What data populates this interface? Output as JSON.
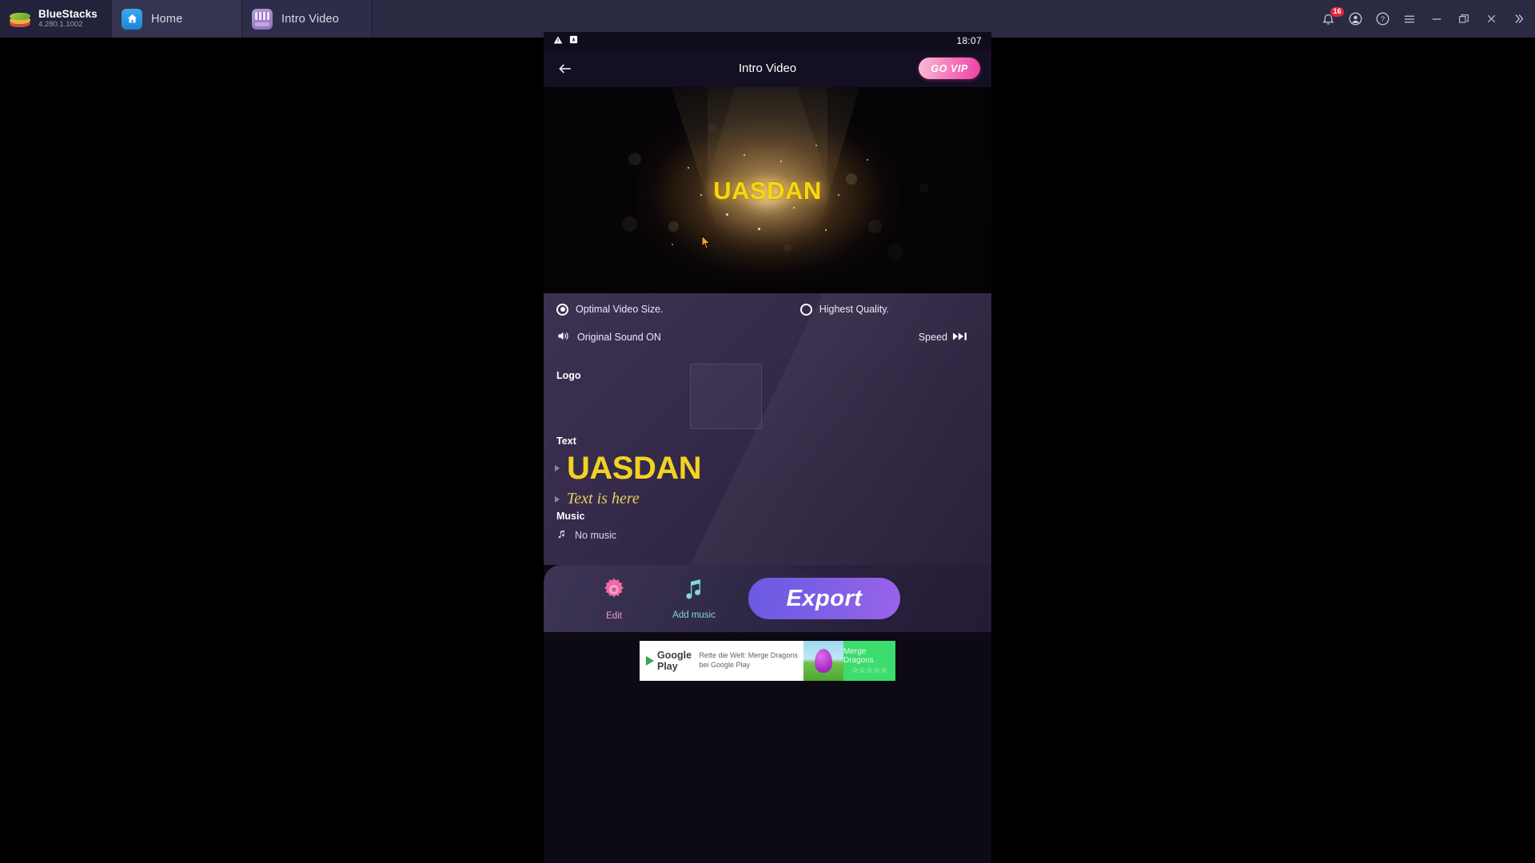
{
  "window": {
    "brand": "BlueStacks",
    "version": "4.280.1.1002",
    "tabs": [
      {
        "label": "Home",
        "icon": "home-icon",
        "active": false
      },
      {
        "label": "Intro Video",
        "icon": "intro-video-app-icon",
        "active": true
      }
    ],
    "system_icons": [
      {
        "name": "notifications-icon",
        "badge": "16"
      },
      {
        "name": "account-icon"
      },
      {
        "name": "help-icon"
      },
      {
        "name": "menu-icon"
      },
      {
        "name": "minimize-icon"
      },
      {
        "name": "restore-icon"
      },
      {
        "name": "close-icon"
      },
      {
        "name": "expand-sidebar-icon"
      }
    ]
  },
  "android": {
    "statusbar": {
      "time": "18:07",
      "icons": [
        "warning-icon",
        "adb-icon"
      ]
    },
    "appbar": {
      "title": "Intro Video",
      "back": "back-arrow-icon",
      "vip_label": "GO VIP"
    }
  },
  "preview": {
    "text": "UASDAN"
  },
  "settings": {
    "quality": {
      "optimal_label": "Optimal Video Size.",
      "optimal_selected": true,
      "highest_label": "Highest Quality.",
      "highest_selected": false
    },
    "sound_label": "Original Sound ON",
    "speed_label": "Speed",
    "logo_label": "Logo",
    "text_label": "Text",
    "text_items": [
      {
        "value": "UASDAN",
        "style": "bold-yellow"
      },
      {
        "value": "Text is here",
        "style": "italic-serif-gold"
      }
    ],
    "music_label": "Music",
    "music_value": "No music"
  },
  "bottombar": {
    "edit_label": "Edit",
    "music_label": "Add music",
    "export_label": "Export"
  },
  "ad": {
    "store": "Google Play",
    "description": "Rette die Welt: Merge Dragons bei Google Play",
    "title": "Merge Dragons",
    "stars": "☆☆☆☆☆"
  },
  "colors": {
    "accent_pink": "#ee3fa8",
    "accent_purple": "#7b5fe6",
    "text_yellow": "#f2d322",
    "chrome": "#2a2a42"
  }
}
